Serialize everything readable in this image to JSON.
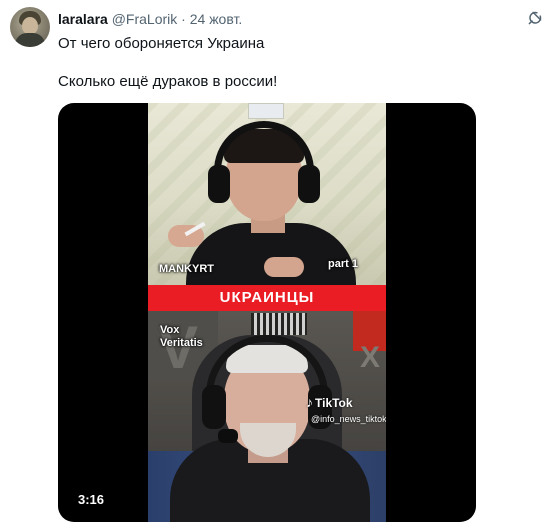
{
  "tweet": {
    "display_name": "laralara",
    "handle": "@FraLorik",
    "separator": "·",
    "date": "24 жовт.",
    "text_line_1": "От чего обороняется Украина",
    "text_line_2": "Сколько ещё дураков в россии!"
  },
  "media": {
    "overlay_top_left": "MANKYRT",
    "overlay_top_right": "part 1",
    "banner": "UКРАИНЦЫ",
    "overlay_bottom_left": "Vox\nVeritatis",
    "tiktok_brand": "TikTok",
    "tiktok_handle": "@info_news_tiktok",
    "duration": "3:16"
  },
  "icons": {
    "grok": "grok-icon",
    "tiktok": "tiktok-logo-icon"
  },
  "colors": {
    "banner": "#ea1c24",
    "handle": "#536471",
    "text": "#0f1419"
  }
}
